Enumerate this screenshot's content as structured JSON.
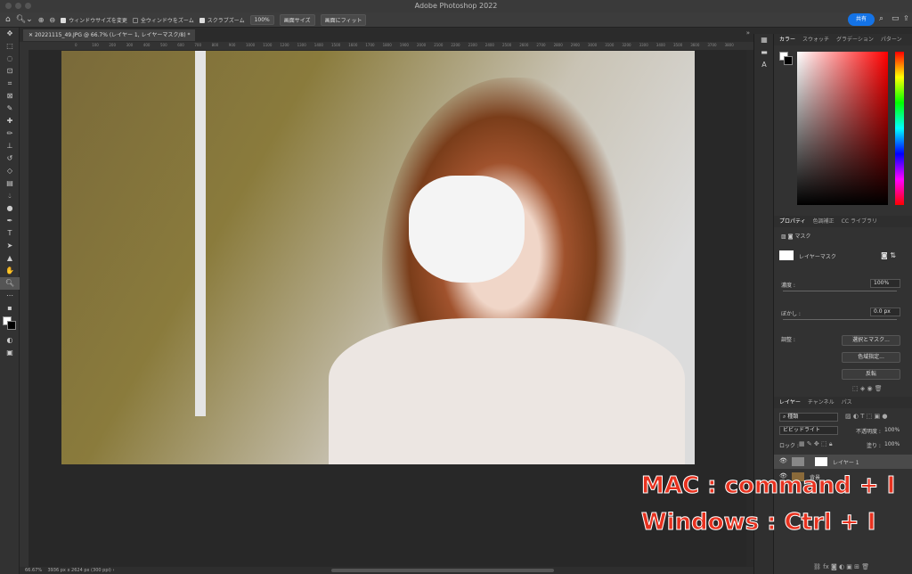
{
  "app_title": "Adobe Photoshop 2022",
  "options_bar": {
    "resize_windows": "ウィンドウサイズを変更",
    "zoom_all": "全ウィンドウをズーム",
    "scrubby_zoom": "スクラブズーム",
    "zoom_value": "100%",
    "fit_screen": "画面サイズ",
    "fill_screen": "画面にフィット",
    "share": "共有"
  },
  "doc_tab": "20221115_49.JPG @ 66.7% (レイヤー 1, レイヤーマスク/8) *",
  "ruler_ticks": [
    "0",
    "100",
    "200",
    "300",
    "400",
    "500",
    "600",
    "700",
    "800",
    "900",
    "1000",
    "1100",
    "1200",
    "1300",
    "1400",
    "1500",
    "1600",
    "1700",
    "1800",
    "1900",
    "2000",
    "2100",
    "2200",
    "2300",
    "2400",
    "2500",
    "2600",
    "2700",
    "2800",
    "2900",
    "3000",
    "3100",
    "3200",
    "3300",
    "3400",
    "3500",
    "3600",
    "3700",
    "3800"
  ],
  "status": {
    "zoom": "66.67%",
    "info": "3936 px x 2624 px (300 ppi)"
  },
  "color_panel": {
    "tabs": [
      "カラー",
      "スウォッチ",
      "グラデーション",
      "パターン"
    ]
  },
  "properties_panel": {
    "tabs": [
      "プロパティ",
      "色調補正",
      "CC ライブラリ"
    ],
    "mask_label": "マスク",
    "layer_mask": "レイヤーマスク",
    "density_label": "濃度 :",
    "density_value": "100%",
    "feather_label": "ぼかし :",
    "feather_value": "0.0 px",
    "adjust_label": "調整 :",
    "select_mask": "選択とマスク...",
    "color_range": "色域指定...",
    "invert": "反転"
  },
  "layers_panel": {
    "tabs": [
      "レイヤー",
      "チャンネル",
      "パス"
    ],
    "filter": "種類",
    "blend_mode": "ビビッドライト",
    "opacity_label": "不透明度 :",
    "opacity_value": "100%",
    "lock_label": "ロック :",
    "fill_label": "塗り :",
    "fill_value": "100%",
    "layers": [
      "レイヤー 1",
      "背景"
    ]
  },
  "overlay": {
    "mac": "MAC : command + I",
    "windows": "Windows : Ctrl + I"
  }
}
